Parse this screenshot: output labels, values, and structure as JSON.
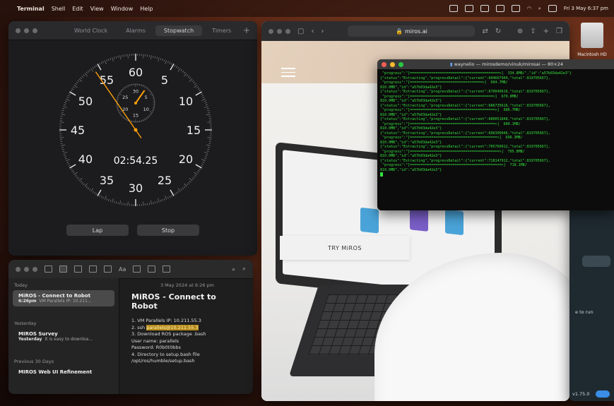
{
  "menubar": {
    "apple_glyph": "",
    "app_name": "Terminal",
    "menus": [
      "Shell",
      "Edit",
      "View",
      "Window",
      "Help"
    ],
    "datetime": "Fri 3 May 6:37 pm"
  },
  "clock": {
    "tabs": [
      "World Clock",
      "Alarms",
      "Stopwatch",
      "Timers"
    ],
    "active_tab": "Stopwatch",
    "dial_numbers": [
      "60",
      "5",
      "10",
      "15",
      "20",
      "25",
      "30",
      "35",
      "40",
      "45",
      "50",
      "55"
    ],
    "sub_dial_numbers": [
      "30",
      "5",
      "10",
      "15",
      "20",
      "25"
    ],
    "elapsed": "02:54.25",
    "lap_label": "Lap",
    "stop_label": "Stop"
  },
  "notes": {
    "sections": {
      "today": "Today",
      "yesterday": "Yesterday",
      "previous": "Previous 30 Days"
    },
    "items": [
      {
        "title": "MiROS - Connect to Robot",
        "time": "6:26pm",
        "preview": "VM Parallels IP: 10.211..."
      },
      {
        "title": "MIROS Survey",
        "time": "Yesterday",
        "preview": "It is easy to downloa..."
      },
      {
        "title": "MIROS Web UI Refinement",
        "time": "",
        "preview": ""
      }
    ],
    "note": {
      "date": "3 May 2024 at 6:26 pm",
      "heading": "MiROS - Connect to Robot",
      "lines": {
        "l1": "1. VM Parallels IP: 10.211.55.3",
        "l2_pre": "2. ssh ",
        "l2_hl": "parallels@10.211.55.3",
        "l3": "3. Download ROS package .bash",
        "l4": "User name: parallels",
        "l5": "Password: R0b0t0bbs",
        "l6": "4. Directory to setup.bash file",
        "l7": "/opt/ros/humble/setup.bash"
      }
    }
  },
  "browser": {
    "url": "miros.ai",
    "cta_label": "TRY MiROS"
  },
  "terminal": {
    "title": "waynelio — mirosdemo/vinuk/mirosai — 80×24",
    "lines": [
      " \"progress\":\"[==========================================>]  334.8MB/\",\"id\":\"a57b03da42e3\"}",
      "{\"status\":\"Extracting\",\"progressDetail\":{\"current\":604667904,\"total\":819705667},",
      " \"progress\":\"[==================================>]  604.7MB/",
      "810.0MB\",\"id\":\"a57b03da42e3\"}",
      "{\"status\":\"Extracting\",\"progressDetail\":{\"current\":670040616,\"total\":819705667},",
      " \"progress\":\"[=======================================>]  670.0MB/",
      "810.0MB\",\"id\":\"a57b03da42e3\"}",
      "{\"status\":\"Extracting\",\"progressDetail\":{\"current\":686735616,\"total\":819705667},",
      " \"progress\":\"[========================================>]  686.7MB/",
      "810.0MB\",\"id\":\"a57b03da42e3\"}",
      "{\"status\":\"Extracting\",\"progressDetail\":{\"current\":680051848,\"total\":819705667},",
      " \"progress\":\"[========================================>]  680.1MB/",
      "810.0MB\",\"id\":\"a57b03da42e3\"}",
      "{\"status\":\"Extracting\",\"progressDetail\":{\"current\":696300946,\"total\":819705667},",
      " \"progress\":\"[=========================================>]  696.3MB/",
      "810.0MB\",\"id\":\"a57b03da42e3\"}",
      "{\"status\":\"Extracting\",\"progressDetail\":{\"current\":705769912,\"total\":819705667},",
      " \"progress\":\"[==========================================>]  705.8MB/",
      "810.0MB\",\"id\":\"a57b03da42e3\"}",
      "{\"status\":\"Extracting\",\"progressDetail\":{\"current\":718147912,\"total\":819705667},",
      " \"progress\":\"[===========================================>]  718.1MB/",
      "810.0MB\",\"id\":\"a57b03da42e3\"}"
    ]
  },
  "desktop": {
    "disk_label": "Macintosh HD"
  },
  "rightwin": {
    "text": "e to run",
    "version": "v1.75.0"
  },
  "colors": {
    "stopwatch_hand": "#ff9f0a",
    "terminal_green": "#35e03e",
    "highlight": "#b58a18"
  },
  "stopwatch_seconds": 54.25,
  "stopwatch_minutes": 2.9
}
